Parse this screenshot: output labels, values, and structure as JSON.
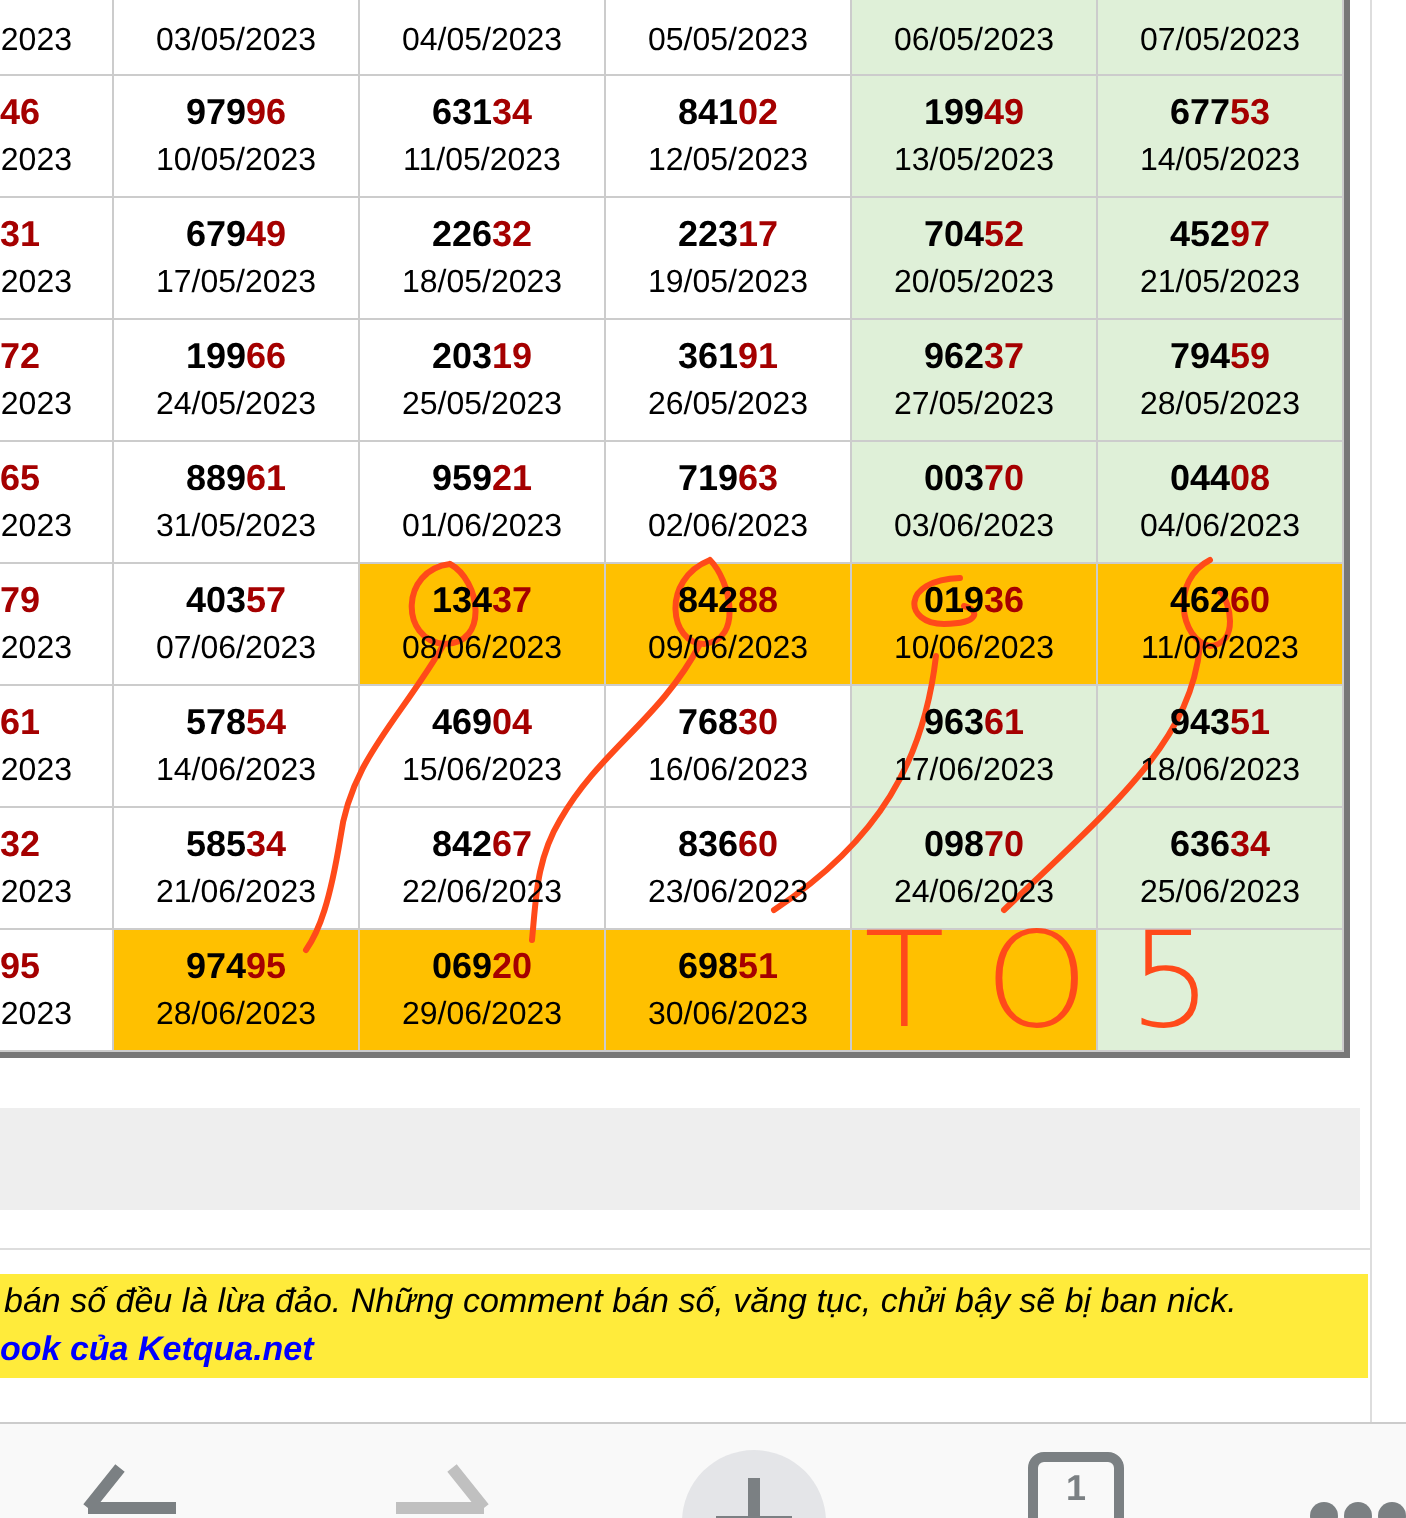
{
  "table": {
    "rows": [
      {
        "cells": [
          {
            "date": "2023",
            "highlighted": false,
            "weekend": false
          },
          {
            "date": "03/05/2023",
            "highlighted": false,
            "weekend": false
          },
          {
            "date": "04/05/2023",
            "highlighted": false,
            "weekend": false
          },
          {
            "date": "05/05/2023",
            "highlighted": false,
            "weekend": false
          },
          {
            "date": "06/05/2023",
            "highlighted": false,
            "weekend": true
          },
          {
            "date": "07/05/2023",
            "highlighted": false,
            "weekend": true
          }
        ]
      },
      {
        "cells": [
          {
            "tail": "46",
            "date": "2023",
            "highlighted": false,
            "weekend": false
          },
          {
            "lead": "979",
            "tail": "96",
            "date": "10/05/2023",
            "highlighted": false,
            "weekend": false
          },
          {
            "lead": "631",
            "tail": "34",
            "date": "11/05/2023",
            "highlighted": false,
            "weekend": false
          },
          {
            "lead": "841",
            "tail": "02",
            "date": "12/05/2023",
            "highlighted": false,
            "weekend": false
          },
          {
            "lead": "199",
            "tail": "49",
            "date": "13/05/2023",
            "highlighted": false,
            "weekend": true
          },
          {
            "lead": "677",
            "tail": "53",
            "date": "14/05/2023",
            "highlighted": false,
            "weekend": true
          }
        ]
      },
      {
        "cells": [
          {
            "tail": "31",
            "date": "2023",
            "highlighted": false,
            "weekend": false
          },
          {
            "lead": "679",
            "tail": "49",
            "date": "17/05/2023",
            "highlighted": false,
            "weekend": false
          },
          {
            "lead": "226",
            "tail": "32",
            "date": "18/05/2023",
            "highlighted": false,
            "weekend": false
          },
          {
            "lead": "223",
            "tail": "17",
            "date": "19/05/2023",
            "highlighted": false,
            "weekend": false
          },
          {
            "lead": "704",
            "tail": "52",
            "date": "20/05/2023",
            "highlighted": false,
            "weekend": true
          },
          {
            "lead": "452",
            "tail": "97",
            "date": "21/05/2023",
            "highlighted": false,
            "weekend": true
          }
        ]
      },
      {
        "cells": [
          {
            "tail": "72",
            "date": "2023",
            "highlighted": false,
            "weekend": false
          },
          {
            "lead": "199",
            "tail": "66",
            "date": "24/05/2023",
            "highlighted": false,
            "weekend": false
          },
          {
            "lead": "203",
            "tail": "19",
            "date": "25/05/2023",
            "highlighted": false,
            "weekend": false
          },
          {
            "lead": "361",
            "tail": "91",
            "date": "26/05/2023",
            "highlighted": false,
            "weekend": false
          },
          {
            "lead": "962",
            "tail": "37",
            "date": "27/05/2023",
            "highlighted": false,
            "weekend": true
          },
          {
            "lead": "794",
            "tail": "59",
            "date": "28/05/2023",
            "highlighted": false,
            "weekend": true
          }
        ]
      },
      {
        "cells": [
          {
            "tail": "65",
            "date": "2023",
            "highlighted": false,
            "weekend": false
          },
          {
            "lead": "889",
            "tail": "61",
            "date": "31/05/2023",
            "highlighted": false,
            "weekend": false
          },
          {
            "lead": "959",
            "tail": "21",
            "date": "01/06/2023",
            "highlighted": false,
            "weekend": false
          },
          {
            "lead": "719",
            "tail": "63",
            "date": "02/06/2023",
            "highlighted": false,
            "weekend": false
          },
          {
            "lead": "003",
            "tail": "70",
            "date": "03/06/2023",
            "highlighted": false,
            "weekend": true
          },
          {
            "lead": "044",
            "tail": "08",
            "date": "04/06/2023",
            "highlighted": false,
            "weekend": true
          }
        ]
      },
      {
        "cells": [
          {
            "tail": "79",
            "date": "2023",
            "highlighted": false,
            "weekend": false
          },
          {
            "lead": "403",
            "tail": "57",
            "date": "07/06/2023",
            "highlighted": false,
            "weekend": false
          },
          {
            "lead": "134",
            "tail": "37",
            "date": "08/06/2023",
            "highlighted": true
          },
          {
            "lead": "842",
            "tail": "88",
            "date": "09/06/2023",
            "highlighted": true
          },
          {
            "lead": "019",
            "tail": "36",
            "date": "10/06/2023",
            "highlighted": true
          },
          {
            "lead": "462",
            "tail": "60",
            "date": "11/06/2023",
            "highlighted": true
          }
        ]
      },
      {
        "cells": [
          {
            "tail": "61",
            "date": "2023",
            "highlighted": false,
            "weekend": false
          },
          {
            "lead": "578",
            "tail": "54",
            "date": "14/06/2023",
            "highlighted": false,
            "weekend": false
          },
          {
            "lead": "469",
            "tail": "04",
            "date": "15/06/2023",
            "highlighted": false,
            "weekend": false
          },
          {
            "lead": "768",
            "tail": "30",
            "date": "16/06/2023",
            "highlighted": false,
            "weekend": false
          },
          {
            "lead": "963",
            "tail": "61",
            "date": "17/06/2023",
            "highlighted": false,
            "weekend": true
          },
          {
            "lead": "943",
            "tail": "51",
            "date": "18/06/2023",
            "highlighted": false,
            "weekend": true
          }
        ]
      },
      {
        "cells": [
          {
            "tail": "32",
            "date": "2023",
            "highlighted": false,
            "weekend": false
          },
          {
            "lead": "585",
            "tail": "34",
            "date": "21/06/2023",
            "highlighted": false,
            "weekend": false
          },
          {
            "lead": "842",
            "tail": "67",
            "date": "22/06/2023",
            "highlighted": false,
            "weekend": false
          },
          {
            "lead": "836",
            "tail": "60",
            "date": "23/06/2023",
            "highlighted": false,
            "weekend": false
          },
          {
            "lead": "098",
            "tail": "70",
            "date": "24/06/2023",
            "highlighted": false,
            "weekend": true
          },
          {
            "lead": "636",
            "tail": "34",
            "date": "25/06/2023",
            "highlighted": false,
            "weekend": true
          }
        ]
      },
      {
        "cells": [
          {
            "tail": "95",
            "date": "2023",
            "highlighted": false,
            "weekend": false
          },
          {
            "lead": "974",
            "tail": "95",
            "date": "28/06/2023",
            "highlighted": true
          },
          {
            "lead": "069",
            "tail": "20",
            "date": "29/06/2023",
            "highlighted": true
          },
          {
            "lead": "698",
            "tail": "51",
            "date": "30/06/2023",
            "highlighted": true
          },
          {
            "highlighted": true
          },
          {
            "highlighted": false,
            "weekend": true
          }
        ]
      }
    ]
  },
  "annotation": {
    "note": "TO5"
  },
  "notice": {
    "text": "bán số đều là lừa đảo. Những comment bán số, văng tục, chửi bậy sẽ bị ban nick.",
    "link": "ook của Ketqua.net"
  },
  "toolbar": {
    "tab_count": "1"
  }
}
